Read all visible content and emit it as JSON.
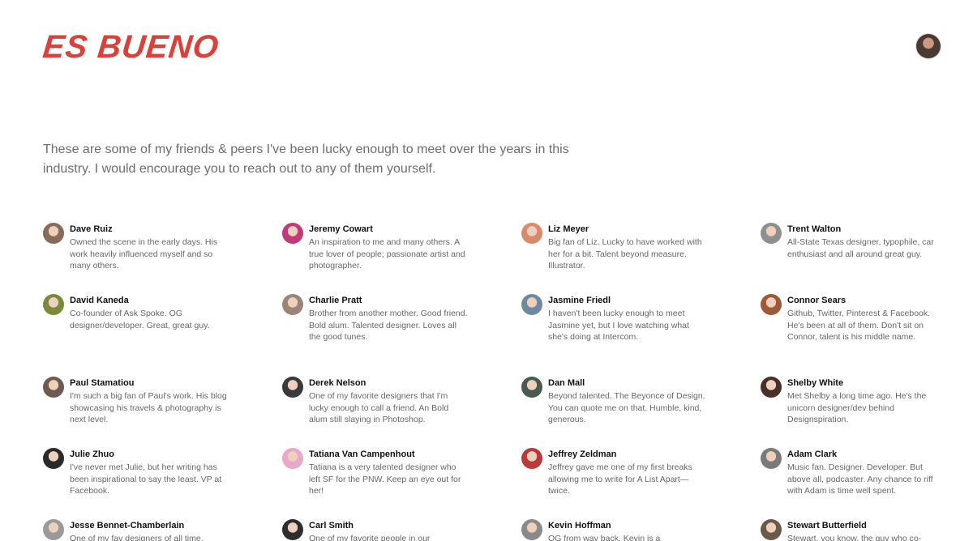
{
  "header": {
    "logo": "ES BUENO"
  },
  "intro": "These are some of my friends & peers I've been lucky enough to meet over the years in this industry. I would encourage you to reach out to any of them yourself.",
  "people": [
    {
      "name": "Dave Ruiz",
      "bio": "Owned the scene in the early days. His work heavily influenced myself and so many others.",
      "color": "#8a6a58"
    },
    {
      "name": "Jeremy Cowart",
      "bio": "An inspiration to me and many others. A true lover of people; passionate artist and photographer.",
      "color": "#c23a78"
    },
    {
      "name": "Liz Meyer",
      "bio": "Big fan of Liz. Lucky to have worked with her for a bit. Talent beyond measure. Illustrator.",
      "color": "#d98a6a"
    },
    {
      "name": "Trent Walton",
      "bio": "All-State Texas designer, typophile, car enthusiast and all around great guy.",
      "color": "#8f8f8f"
    },
    {
      "name": "David Kaneda",
      "bio": "Co-founder of Ask Spoke. OG designer/developer. Great, great guy.",
      "color": "#7a8a3a"
    },
    {
      "name": "Charlie Pratt",
      "bio": "Brother from another mother. Good friend. Bold alum. Talented designer. Loves all the good tunes.",
      "color": "#9a8578"
    },
    {
      "name": "Jasmine Friedl",
      "bio": "I haven't been lucky enough to meet Jasmine yet, but I love watching what she's doing at Intercom.",
      "color": "#6f8aa0"
    },
    {
      "name": "Connor Sears",
      "bio": "Github, Twitter, Pinterest & Facebook. He's been at all of them. Don't sit on Connor, talent is his middle name.",
      "color": "#a0583a"
    },
    {
      "name": "Paul Stamatiou",
      "bio": "I'm such a big fan of Paul's work. His blog showcasing his travels & photography is next level.",
      "color": "#6e5a50"
    },
    {
      "name": "Derek Nelson",
      "bio": "One of my favorite designers that I'm lucky enough to call a friend. An Bold alum still slaying in Photoshop.",
      "color": "#3a3a3a"
    },
    {
      "name": "Dan Mall",
      "bio": "Beyond talented. The Beyonce of Design. You can quote me on that. Humble, kind, generous.",
      "color": "#4a5a50"
    },
    {
      "name": "Shelby White",
      "bio": "Met Shelby a long time ago. He's the unicorn designer/dev behind Designspiration.",
      "color": "#4a3028"
    },
    {
      "name": "Julie Zhuo",
      "bio": "I've never met Julie, but her writing has been inspirational to say the least. VP at Facebook.",
      "color": "#2a2a2a"
    },
    {
      "name": "Tatiana Van Campenhout",
      "bio": "Tatiana is a very talented designer who left SF for the PNW. Keep an eye out for her!",
      "color": "#e8a8c8"
    },
    {
      "name": "Jeffrey Zeldman",
      "bio": "Jeffrey gave me one of my first breaks allowing me to write for A List Apart—twice.",
      "color": "#b83a3a"
    },
    {
      "name": "Adam Clark",
      "bio": "Music fan. Designer. Developer. But above all, podcaster. Any chance to riff with Adam is time well spent.",
      "color": "#7a7a7a"
    },
    {
      "name": "Jesse Bennet-Chamberlain",
      "bio": "One of my fav designers of all time.",
      "color": "#9a9a9a"
    },
    {
      "name": "Carl Smith",
      "bio": "One of my favorite people in our",
      "color": "#2e2e2e"
    },
    {
      "name": "Kevin Hoffman",
      "bio": "OG from way back. Kevin is a",
      "color": "#8a8a8a"
    },
    {
      "name": "Stewart Butterfield",
      "bio": "Stewart, you know, the guy who co-",
      "color": "#6a5a4a"
    }
  ]
}
